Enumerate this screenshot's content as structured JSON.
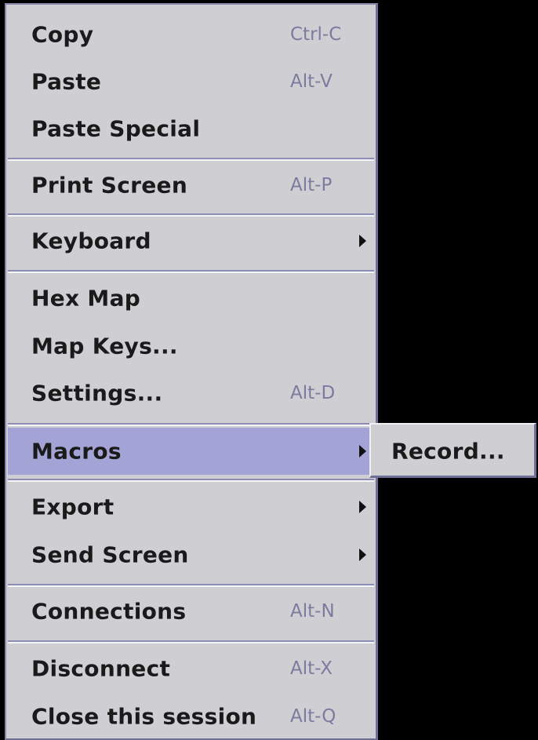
{
  "menu": {
    "items": [
      {
        "label": "Copy",
        "accel": "Ctrl-C"
      },
      {
        "label": "Paste",
        "accel": "Alt-V"
      },
      {
        "label": "Paste Special",
        "accel": ""
      },
      {
        "label": "Print Screen",
        "accel": "Alt-P"
      },
      {
        "label": "Keyboard",
        "accel": ""
      },
      {
        "label": "Hex Map",
        "accel": ""
      },
      {
        "label": "Map Keys...",
        "accel": ""
      },
      {
        "label": "Settings...",
        "accel": "Alt-D"
      },
      {
        "label": "Macros",
        "accel": ""
      },
      {
        "label": "Export",
        "accel": ""
      },
      {
        "label": "Send Screen",
        "accel": ""
      },
      {
        "label": "Connections",
        "accel": "Alt-N"
      },
      {
        "label": "Disconnect",
        "accel": "Alt-X"
      },
      {
        "label": "Close this session",
        "accel": "Alt-Q"
      }
    ]
  },
  "submenu": {
    "items": [
      {
        "label": "Record..."
      }
    ]
  },
  "colors": {
    "menu_background": "#cfcfd3",
    "selected_background": "#a3a3d6",
    "accelerator_text": "#7b7ba0",
    "desktop_background": "#000000"
  }
}
